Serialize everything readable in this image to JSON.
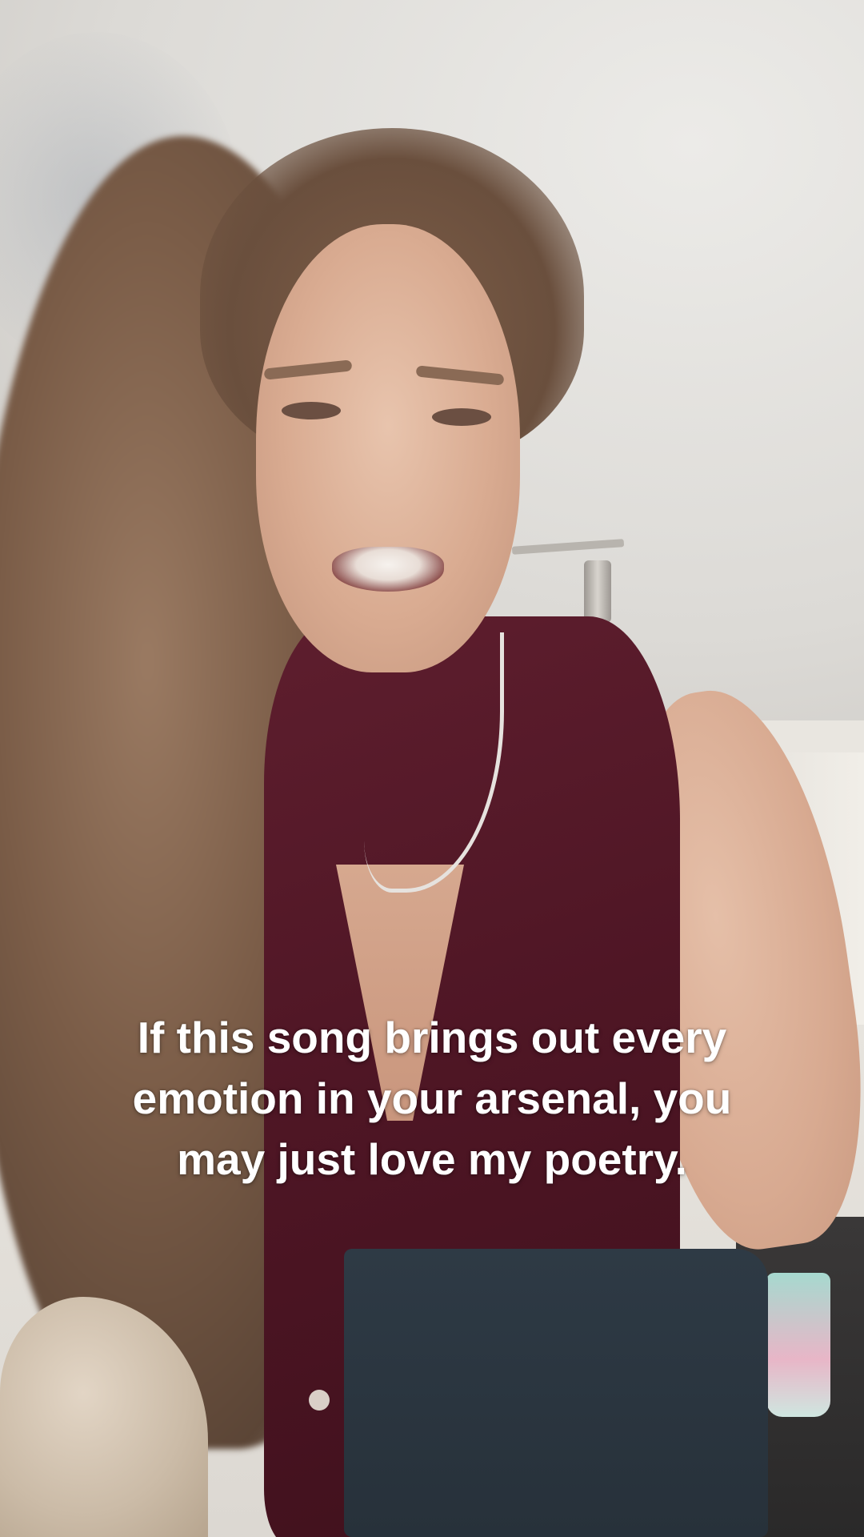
{
  "overlay": {
    "caption": "If this song brings out every emotion in your arsenal, you may just love my poetry."
  },
  "scene": {
    "vest_color": "#4f1625",
    "caption_color": "#ffffff"
  }
}
